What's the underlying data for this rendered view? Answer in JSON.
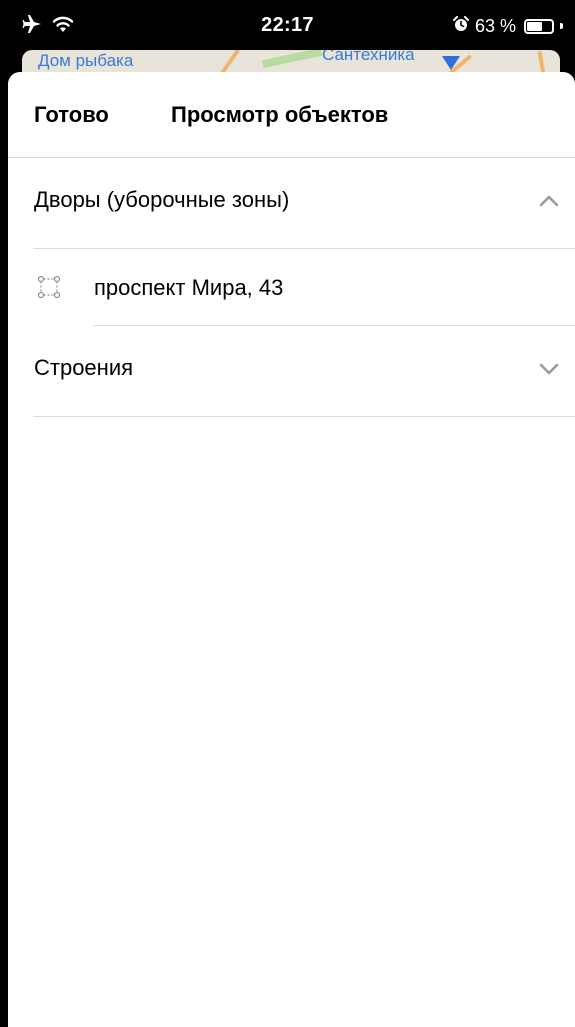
{
  "status_bar": {
    "time": "22:17",
    "battery_percent": "63 %",
    "battery_level": 0.63,
    "icons": [
      "airplane-icon",
      "wifi-icon",
      "alarm-icon",
      "battery-icon"
    ]
  },
  "map": {
    "labels": [
      "Дом рыбака",
      "Сантехника"
    ]
  },
  "header": {
    "done_label": "Готово",
    "title": "Просмотр объектов"
  },
  "sections": [
    {
      "label": "Дворы (уборочные зоны)",
      "expanded": true,
      "chevron": "chevron-up-icon",
      "items": [
        {
          "label": "проспект Мира, 43",
          "icon": "area-polygon-icon"
        }
      ]
    },
    {
      "label": "Строения",
      "expanded": false,
      "chevron": "chevron-down-icon",
      "items": []
    }
  ],
  "colors": {
    "background": "#ffffff",
    "separator": "#dcdcdc",
    "chevron": "#9a9a9a",
    "map_label": "#3a7bd5"
  }
}
